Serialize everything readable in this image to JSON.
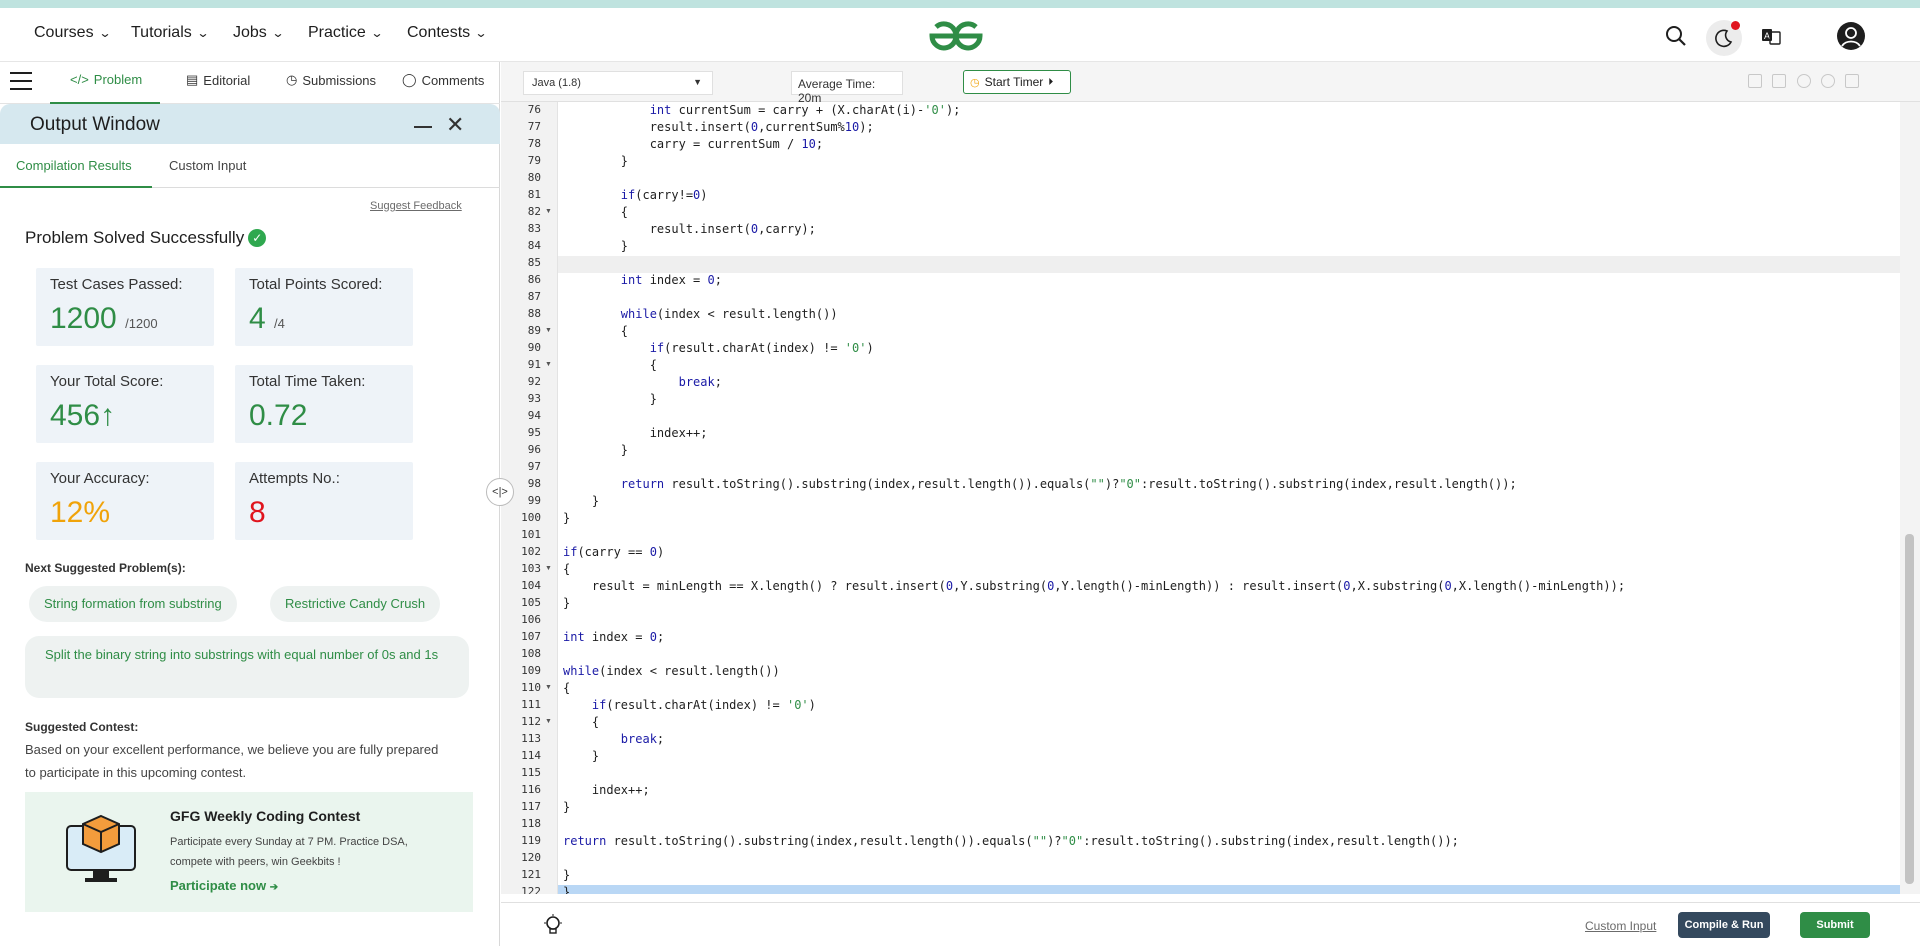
{
  "nav": {
    "items": [
      "Courses",
      "Tutorials",
      "Jobs",
      "Practice",
      "Contests"
    ]
  },
  "lefttabs": {
    "problem": "Problem",
    "editorial": "Editorial",
    "submissions": "Submissions",
    "comments": "Comments"
  },
  "output": {
    "title": "Output Window",
    "tab_results": "Compilation Results",
    "tab_custom": "Custom Input",
    "feedback": "Suggest Feedback",
    "solved": "Problem Solved Successfully",
    "cards": {
      "tests_label": "Test Cases Passed:",
      "tests_value": "1200",
      "tests_total": "/1200",
      "points_label": "Total Points Scored:",
      "points_value": "4",
      "points_total": "/4",
      "score_label": "Your Total Score:",
      "score_value": "456",
      "time_label": "Total Time Taken:",
      "time_value": "0.72",
      "accuracy_label": "Your Accuracy:",
      "accuracy_value": "12%",
      "attempts_label": "Attempts No.:",
      "attempts_value": "8"
    },
    "next_title": "Next Suggested Problem(s):",
    "next": [
      "String formation from substring",
      "Restrictive Candy Crush",
      "Split the binary string into substrings with equal number of 0s and 1s"
    ],
    "contest_title": "Suggested Contest:",
    "contest_text": "Based on your excellent performance, we believe you are fully prepared to participate in this upcoming contest.",
    "contest_name": "GFG Weekly Coding Contest",
    "contest_desc": "Participate every Sunday at 7 PM. Practice DSA, compete with peers, win Geekbits !",
    "contest_link": "Participate now"
  },
  "editor": {
    "language": "Java (1.8)",
    "avg_time": "Average Time: 20m",
    "start_timer": "Start Timer",
    "custom_input": "Custom Input",
    "compile_run": "Compile & Run",
    "submit": "Submit",
    "first_line": 76,
    "fold_lines": [
      82,
      89,
      91,
      103,
      110,
      112
    ],
    "code": [
      "            int currentSum = carry + (X.charAt(i)-'0');",
      "            result.insert(0,currentSum%10);",
      "            carry = currentSum / 10;",
      "        }",
      "",
      "        if(carry!=0)",
      "        {",
      "            result.insert(0,carry);",
      "        }",
      "",
      "        int index = 0;",
      "",
      "        while(index < result.length())",
      "        {",
      "            if(result.charAt(index) != '0')",
      "            {",
      "                break;",
      "            }",
      "",
      "            index++;",
      "        }",
      "",
      "        return result.toString().substring(index,result.length()).equals(\"\")?\"0\":result.toString().substring(index,result.length());",
      "    }",
      "}",
      "",
      "if(carry == 0)",
      "{",
      "    result = minLength == X.length() ? result.insert(0,Y.substring(0,Y.length()-minLength)) : result.insert(0,X.substring(0,X.length()-minLength));",
      "}",
      "",
      "int index = 0;",
      "",
      "while(index < result.length())",
      "{",
      "    if(result.charAt(index) != '0')",
      "    {",
      "        break;",
      "    }",
      "",
      "    index++;",
      "}",
      "",
      "return result.toString().substring(index,result.length()).equals(\"\")?\"0\":result.toString().substring(index,result.length());",
      "",
      "}",
      "}"
    ],
    "highlight_line": 85,
    "selected_line": 122
  },
  "colors": {
    "accent": "#2f8d46",
    "accuracy": "#f0a30a",
    "attempts": "#e0141e",
    "output_header": "#d6e8ef"
  }
}
